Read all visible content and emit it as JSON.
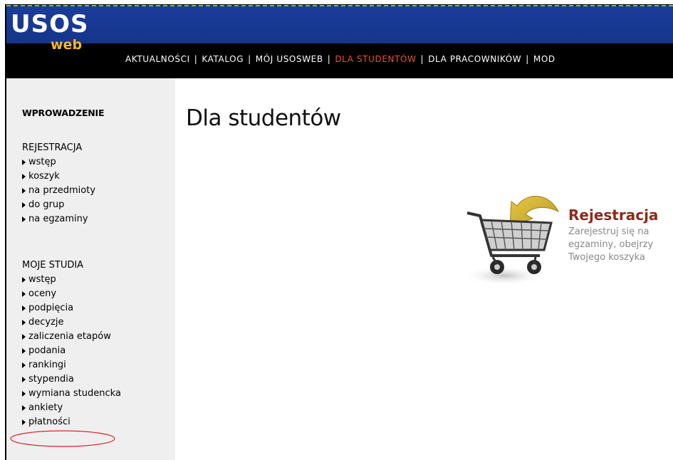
{
  "logo": {
    "usos": "USOS",
    "web": "web"
  },
  "nav": [
    {
      "label": "AKTUALNOŚCI",
      "active": false
    },
    {
      "label": "KATALOG",
      "active": false
    },
    {
      "label": "MÓJ USOSWEB",
      "active": false
    },
    {
      "label": "DLA STUDENTÓW",
      "active": true
    },
    {
      "label": "DLA PRACOWNIKÓW",
      "active": false
    },
    {
      "label": "MOD",
      "active": false
    }
  ],
  "nav_separator": "|",
  "sidebar": {
    "intro": "WPROWADZENIE",
    "rejestracja": {
      "title": "REJESTRACJA",
      "items": [
        "wstęp",
        "koszyk",
        "na przedmioty",
        "do grup",
        "na egzaminy"
      ]
    },
    "moje_studia": {
      "title": "MOJE STUDIA",
      "items": [
        "wstęp",
        "oceny",
        "podpięcia",
        "decyzje",
        "zaliczenia etapów",
        "podania",
        "rankingi",
        "stypendia",
        "wymiana studencka",
        "ankiety",
        "płatności"
      ]
    }
  },
  "main": {
    "title": "Dla studentów",
    "card": {
      "title": "Rejestracja",
      "lines": [
        "Zarejestruj się na",
        "egzaminy, obejrzy",
        "Twojego koszyka"
      ]
    }
  },
  "colors": {
    "header_blue": "#1a3d9a",
    "nav_active": "#e0573a",
    "logo_web": "#f7b728",
    "card_title": "#8b2c1c",
    "annotation_circle": "#d9262b"
  }
}
